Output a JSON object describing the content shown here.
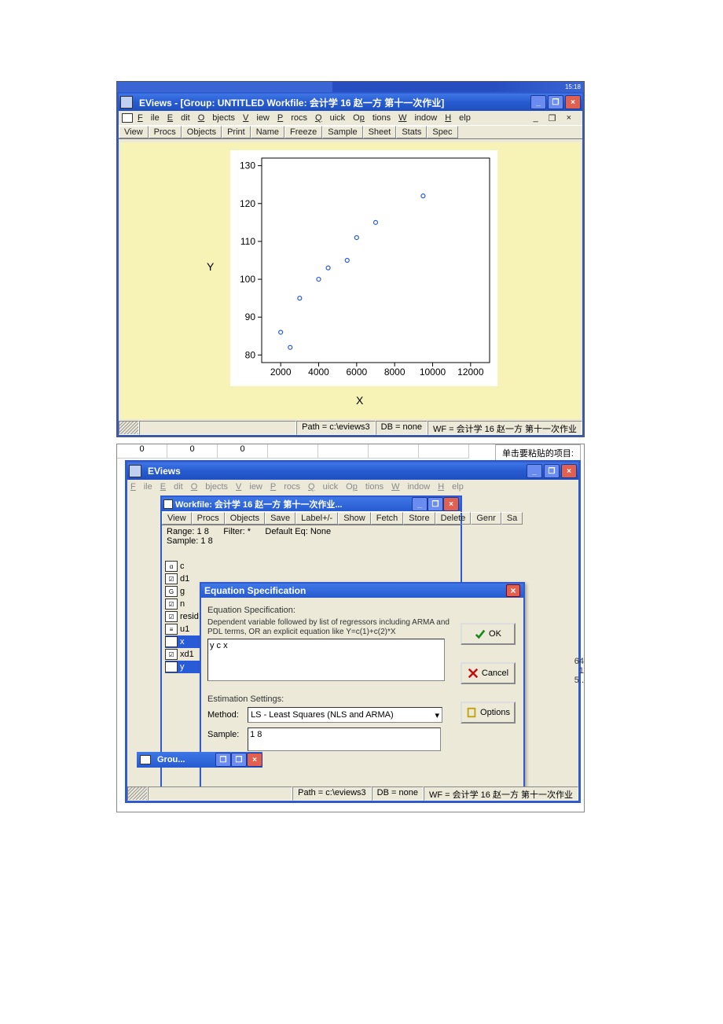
{
  "top": {
    "taskbar_items": [
      "",
      "",
      "",
      "",
      "",
      ""
    ],
    "tray_time": "15:18",
    "title": "EViews - [Group: UNTITLED    Workfile: 会计学 16 赵一方 第十一次作业]",
    "menus": [
      "File",
      "Edit",
      "Objects",
      "View",
      "Procs",
      "Quick",
      "Options",
      "Window",
      "Help"
    ],
    "mdi_sys": [
      "_",
      "❐",
      "×"
    ],
    "toolbar": [
      "View",
      "Procs",
      "Objects",
      "Print",
      "Name",
      "Freeze",
      "Sample",
      "Sheet",
      "Stats",
      "Spec"
    ],
    "status": {
      "path": "Path = c:\\eviews3",
      "db": "DB = none",
      "wf": "WF = 会计学 16 赵一方 第十一次作业"
    }
  },
  "chart_data": {
    "type": "scatter",
    "xlabel": "X",
    "ylabel": "Y",
    "xticks": [
      2000,
      4000,
      6000,
      8000,
      10000,
      12000
    ],
    "yticks": [
      80,
      90,
      100,
      110,
      120,
      130
    ],
    "xlim": [
      1000,
      13000
    ],
    "ylim": [
      78,
      132
    ],
    "points": [
      {
        "x": 2000,
        "y": 86
      },
      {
        "x": 2500,
        "y": 82
      },
      {
        "x": 3000,
        "y": 95
      },
      {
        "x": 4000,
        "y": 100
      },
      {
        "x": 4500,
        "y": 103
      },
      {
        "x": 5500,
        "y": 105
      },
      {
        "x": 6000,
        "y": 111
      },
      {
        "x": 7000,
        "y": 115
      },
      {
        "x": 9500,
        "y": 122
      }
    ]
  },
  "bottom": {
    "excel_row": [
      "0",
      "0",
      "0"
    ],
    "paste_hint": "单击要粘贴的项目:",
    "title": "EViews",
    "menus": [
      "File",
      "Edit",
      "Objects",
      "View",
      "Procs",
      "Quick",
      "Options",
      "Window",
      "Help"
    ],
    "workfile": {
      "title": "Workfile: 会计学 16 赵一方 第十一次作业...",
      "toolbar": [
        "View",
        "Procs",
        "Objects",
        "Save",
        "Label+/-",
        "Show",
        "Fetch",
        "Store",
        "Delete",
        "Genr",
        "Sa"
      ],
      "range_lbl": "Range:",
      "range": "1 8",
      "filter_lbl": "Filter:",
      "filter": "*",
      "default_eq_lbl": "Default Eq:",
      "default_eq": "None",
      "sample_lbl": "Sample:",
      "sample": "1 8",
      "objects": [
        {
          "icon": "α",
          "name": "c"
        },
        {
          "icon": "☑",
          "name": "d1"
        },
        {
          "icon": "G",
          "name": "g"
        },
        {
          "icon": "☑",
          "name": "n"
        },
        {
          "icon": "☑",
          "name": "resid"
        },
        {
          "icon": "≡",
          "name": "u1"
        },
        {
          "icon": "☑",
          "name": "x",
          "sel": true
        },
        {
          "icon": "☑",
          "name": "xd1"
        },
        {
          "icon": "☑",
          "name": "y",
          "sel": true
        }
      ]
    },
    "eq": {
      "title": "Equation Specification",
      "spec_lbl": "Equation Specification:",
      "spec_desc": "Dependent variable followed by list of regressors including ARMA and PDL terms, OR an explicit equation like Y=c(1)+c(2)*X",
      "spec_value": "y c x",
      "est_lbl": "Estimation Settings:",
      "method_lbl": "Method:",
      "method": "LS - Least Squares (NLS and ARMA)",
      "sample_lbl": "Sample:",
      "sample": "1 8",
      "btn_ok": "OK",
      "btn_cancel": "Cancel",
      "btn_options": "Options"
    },
    "group_min": "Grou...",
    "status": {
      "path": "Path = c:\\eviews3",
      "db": "DB = none",
      "wf": "WF = 会计学 16 赵一方 第十一次作业"
    },
    "side_nums": [
      "64",
      "1",
      "5.."
    ]
  }
}
